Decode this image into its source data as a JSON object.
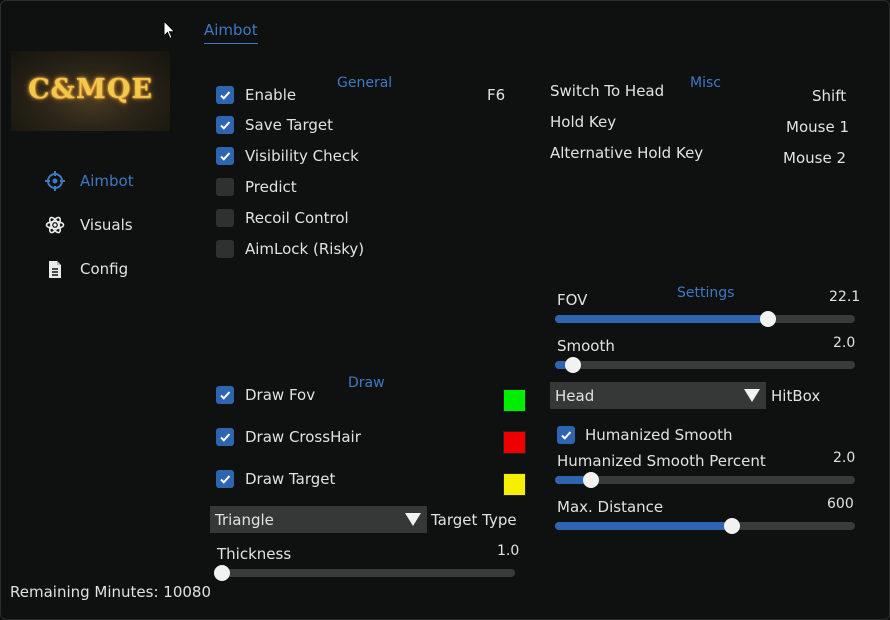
{
  "logo_text": "C&MQE",
  "sidebar": {
    "items": [
      {
        "label": "Aimbot",
        "icon": "crosshair-icon",
        "active": true
      },
      {
        "label": "Visuals",
        "icon": "atom-icon",
        "active": false
      },
      {
        "label": "Config",
        "icon": "document-icon",
        "active": false
      }
    ],
    "remaining": "Remaining Minutes: 10080"
  },
  "tab": "Aimbot",
  "general": {
    "title": "General",
    "hotkey": "F6",
    "items": [
      {
        "label": "Enable",
        "checked": true
      },
      {
        "label": "Save Target",
        "checked": true
      },
      {
        "label": "Visibility Check",
        "checked": true
      },
      {
        "label": "Predict",
        "checked": false
      },
      {
        "label": "Recoil Control",
        "checked": false
      },
      {
        "label": "AimLock (Risky)",
        "checked": false
      }
    ]
  },
  "misc": {
    "title": "Misc",
    "rows": [
      {
        "label": "Switch To Head",
        "value": "Shift"
      },
      {
        "label": "Hold Key",
        "value": "Mouse 1"
      },
      {
        "label": "Alternative Hold Key",
        "value": "Mouse 2"
      }
    ]
  },
  "draw": {
    "title": "Draw",
    "items": [
      {
        "label": "Draw Fov",
        "checked": true,
        "color": "#00ee00"
      },
      {
        "label": "Draw CrossHair",
        "checked": true,
        "color": "#ee0000"
      },
      {
        "label": "Draw Target",
        "checked": true,
        "color": "#f5f000"
      }
    ],
    "target_type": {
      "value": "Triangle",
      "label": "Target Type"
    },
    "thickness": {
      "label": "Thickness",
      "value": "1.0",
      "fraction": 0.0
    }
  },
  "settings": {
    "title": "Settings",
    "fov": {
      "label": "FOV",
      "value": "22.1",
      "fraction": 0.71
    },
    "smooth": {
      "label": "Smooth",
      "value": "2.0",
      "fraction": 0.06
    },
    "hitbox": {
      "value": "Head",
      "label": "HitBox"
    },
    "humanized": {
      "label": "Humanized Smooth",
      "checked": true
    },
    "humanized_percent": {
      "label": "Humanized Smooth Percent",
      "value": "2.0",
      "fraction": 0.12
    },
    "max_distance": {
      "label": "Max. Distance",
      "value": "600",
      "fraction": 0.59
    }
  },
  "colors": {
    "accent": "#3f78c3",
    "checkbox_on": "#2d65b0"
  }
}
